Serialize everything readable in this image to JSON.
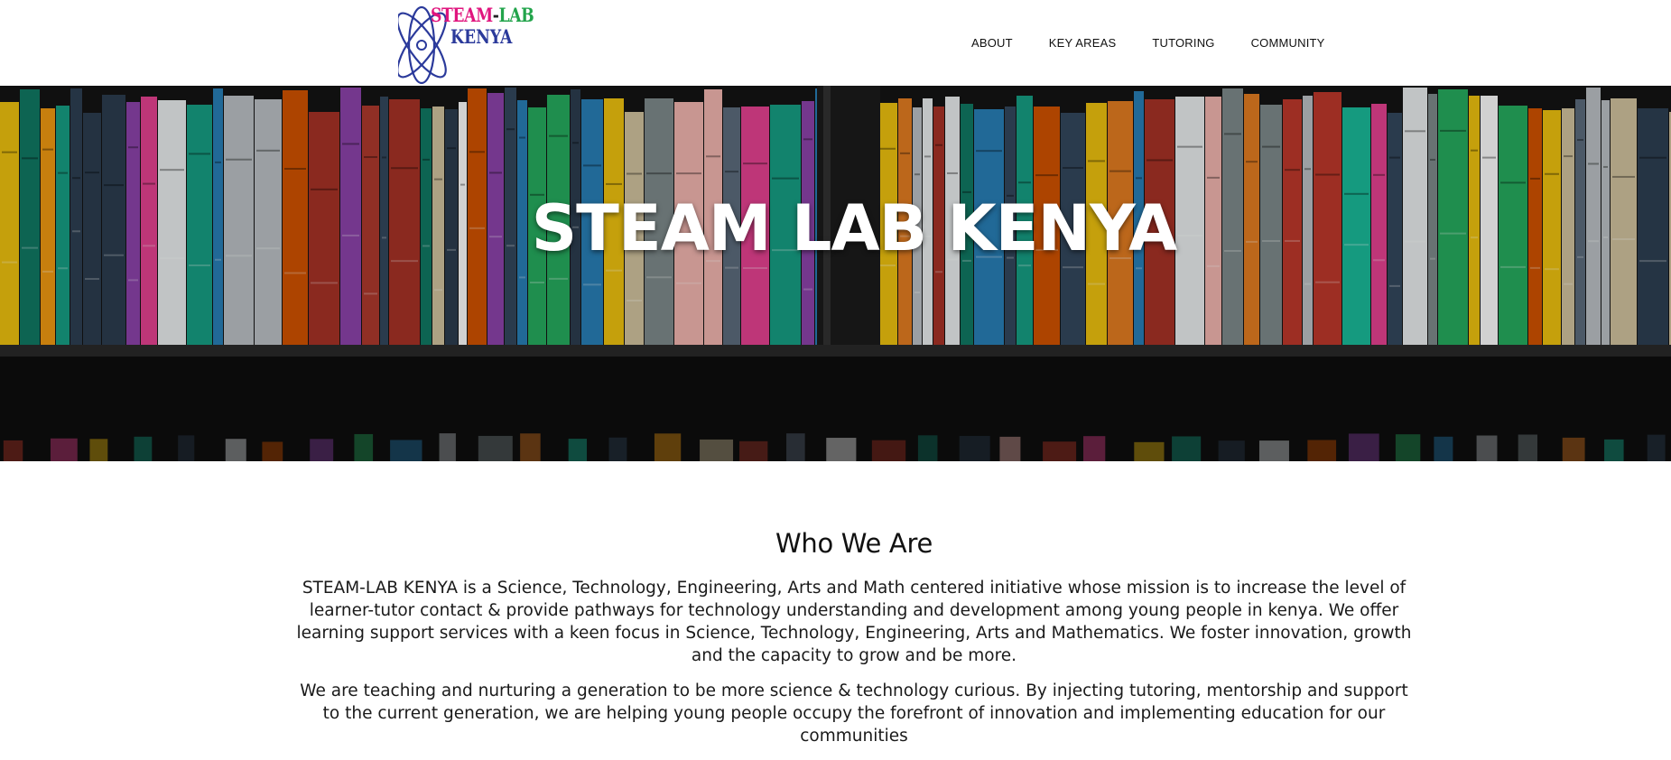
{
  "logo": {
    "line1_part1": "STEAM",
    "line1_dash": "-",
    "line1_part2": "LAB",
    "line2": "KENYA"
  },
  "nav": {
    "items": [
      {
        "label": "ABOUT"
      },
      {
        "label": "KEY AREAS"
      },
      {
        "label": "TUTORING"
      },
      {
        "label": "COMMUNITY"
      }
    ]
  },
  "hero": {
    "title": "STEAM LAB KENYA"
  },
  "about": {
    "title": "Who We Are",
    "paragraph1": "STEAM-LAB KENYA is a Science, Technology, Engineering, Arts and Math centered initiative whose mission is to increase the level of learner-tutor contact & provide pathways for technology understanding and development among young people in kenya. We offer learning support services with a keen focus in Science, Technology, Engineering, Arts and Mathematics. We foster innovation, growth and the capacity to grow and be more.",
    "paragraph2": "We are teaching and nurturing a generation to be more science & technology curious. By injecting tutoring, mentorship and support to the current generation, we are helping young people occupy the forefront of innovation and implementing education for our communities"
  },
  "colors": {
    "logo_pink": "#e0157e",
    "logo_green": "#22a44b",
    "logo_blue": "#2b3a9b"
  }
}
